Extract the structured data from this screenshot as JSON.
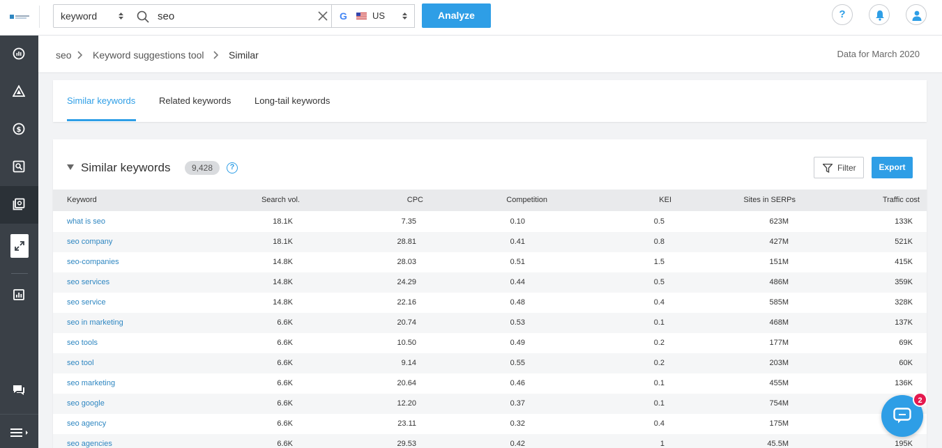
{
  "header": {
    "search_type": "keyword",
    "search_value": "seo",
    "database_country": "US",
    "analyze_label": "Analyze",
    "help_label": "?"
  },
  "breadcrumb": {
    "items": [
      "seo",
      "Keyword suggestions tool",
      "Similar"
    ],
    "data_for": "Data for March 2020"
  },
  "tabs": [
    {
      "label": "Similar keywords",
      "active": true
    },
    {
      "label": "Related keywords",
      "active": false
    },
    {
      "label": "Long-tail keywords",
      "active": false
    }
  ],
  "panel": {
    "title": "Similar keywords",
    "count": "9,428",
    "filter_label": "Filter",
    "export_label": "Export"
  },
  "table": {
    "columns": [
      "Keyword",
      "Search vol.",
      "CPC",
      "Competition",
      "KEI",
      "Sites in SERPs",
      "Traffic cost"
    ],
    "rows": [
      [
        "what is seo",
        "18.1K",
        "7.35",
        "0.10",
        "0.5",
        "623M",
        "133K"
      ],
      [
        "seo company",
        "18.1K",
        "28.81",
        "0.41",
        "0.8",
        "427M",
        "521K"
      ],
      [
        "seo-companies",
        "14.8K",
        "28.03",
        "0.51",
        "1.5",
        "151M",
        "415K"
      ],
      [
        "seo services",
        "14.8K",
        "24.29",
        "0.44",
        "0.5",
        "486M",
        "359K"
      ],
      [
        "seo service",
        "14.8K",
        "22.16",
        "0.48",
        "0.4",
        "585M",
        "328K"
      ],
      [
        "seo in marketing",
        "6.6K",
        "20.74",
        "0.53",
        "0.1",
        "468M",
        "137K"
      ],
      [
        "seo tools",
        "6.6K",
        "10.50",
        "0.49",
        "0.2",
        "177M",
        "69K"
      ],
      [
        "seo tool",
        "6.6K",
        "9.14",
        "0.55",
        "0.2",
        "203M",
        "60K"
      ],
      [
        "seo marketing",
        "6.6K",
        "20.64",
        "0.46",
        "0.1",
        "455M",
        "136K"
      ],
      [
        "seo google",
        "6.6K",
        "12.20",
        "0.37",
        "0.1",
        "754M",
        ""
      ],
      [
        "seo agency",
        "6.6K",
        "23.11",
        "0.32",
        "0.4",
        "175M",
        ""
      ],
      [
        "seo agencies",
        "6.6K",
        "29.53",
        "0.42",
        "1",
        "45.5M",
        "195K"
      ]
    ]
  },
  "chat": {
    "badge": "2"
  },
  "colors": {
    "accent": "#2e9ee6",
    "sidebar": "#3a4047",
    "link": "#2e86c1",
    "badge": "#e5194e"
  }
}
